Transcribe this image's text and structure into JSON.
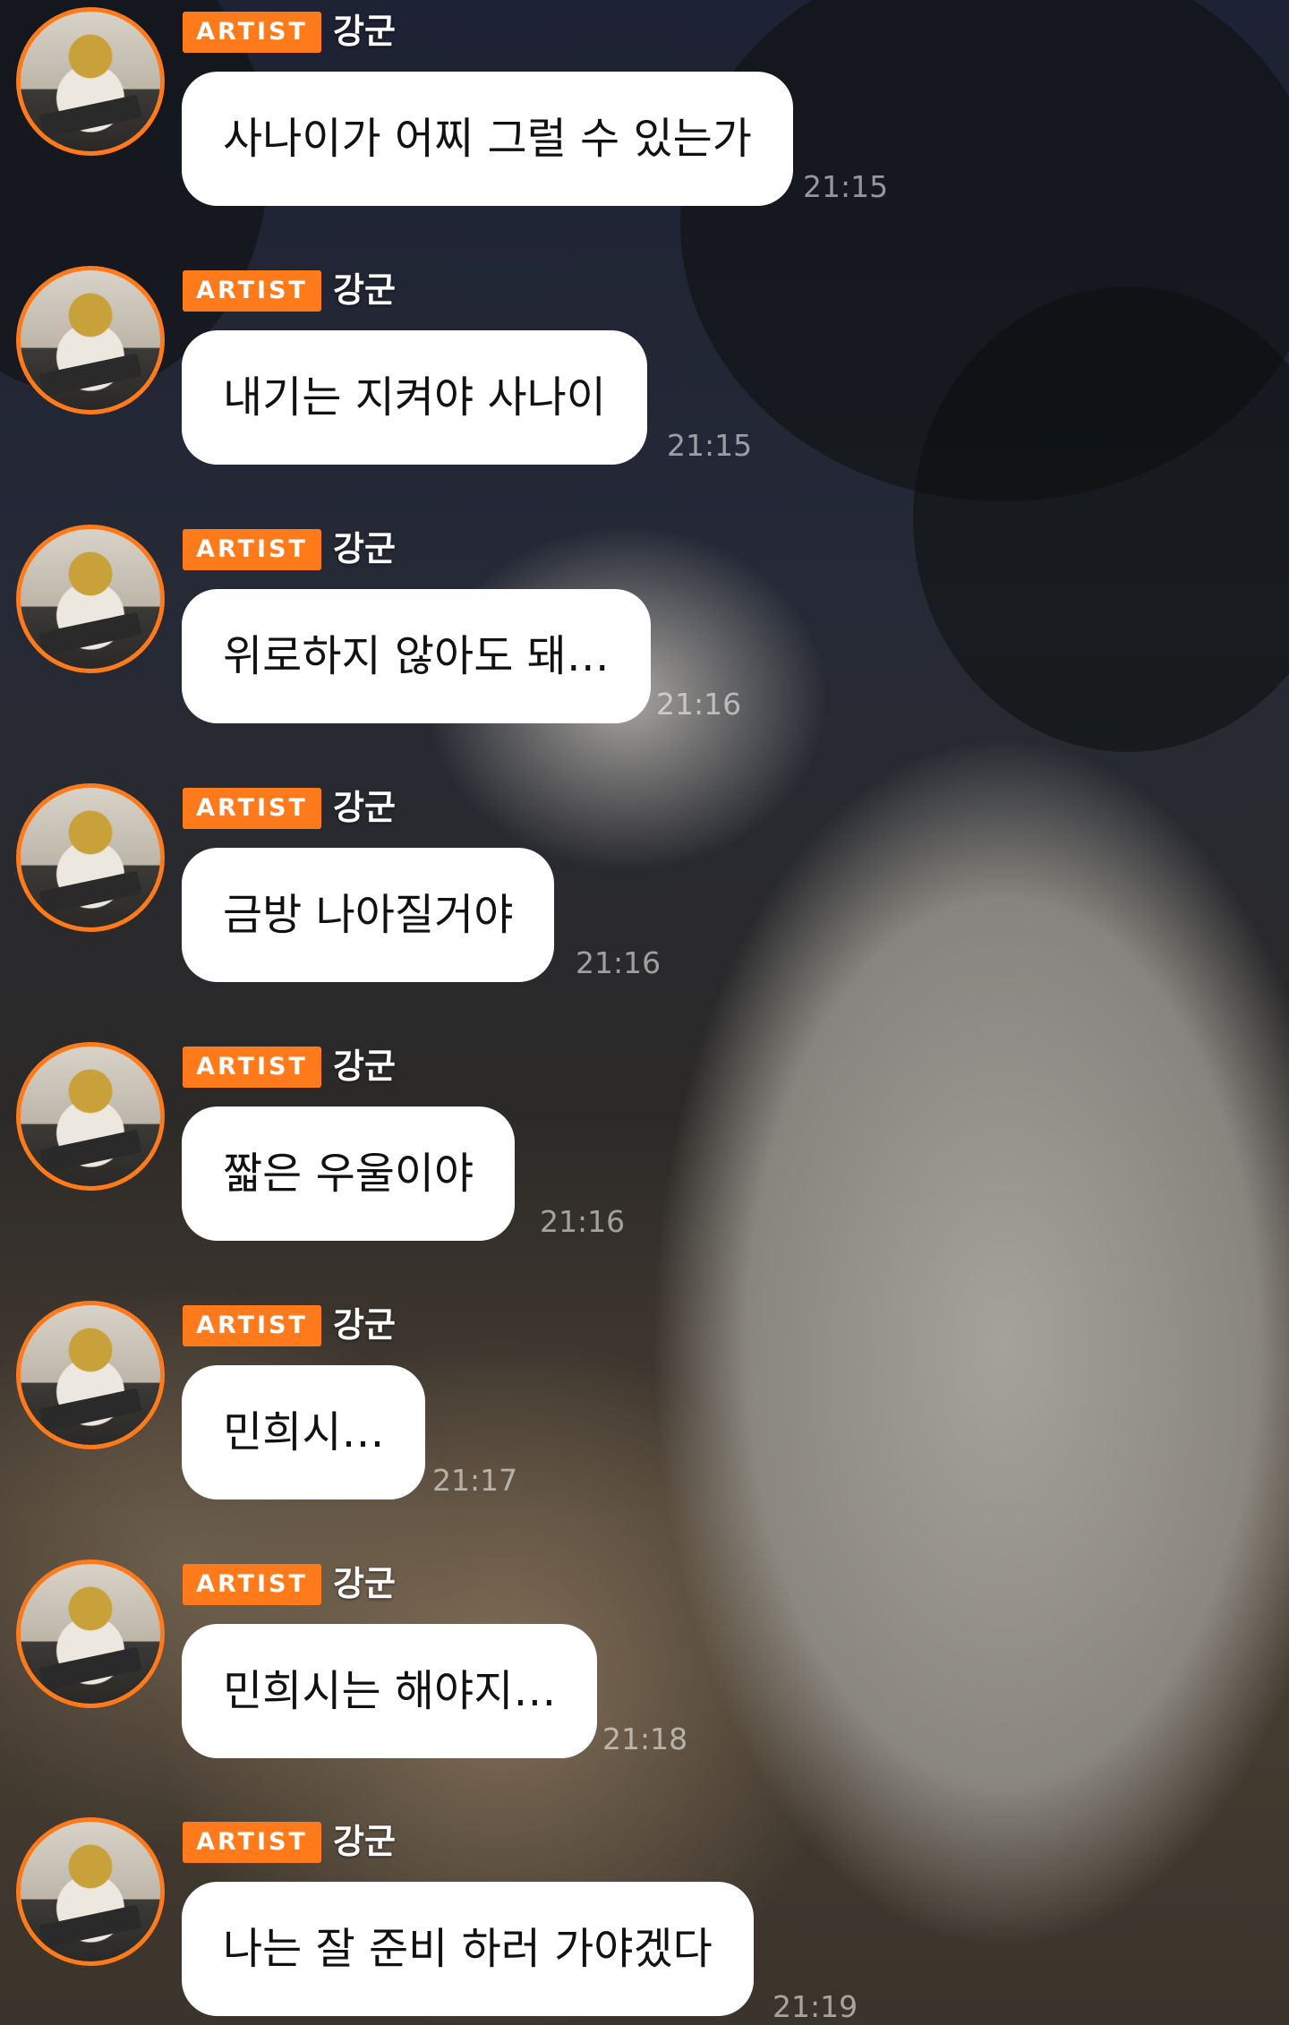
{
  "badge_label": "ARTIST",
  "accent_color": "#ff7a1a",
  "messages": [
    {
      "sender": "강군",
      "text": "사나이가 어찌 그럴 수 있는가",
      "time": "21:15"
    },
    {
      "sender": "강군",
      "text": "내기는 지켜야 사나이",
      "time": "21:15"
    },
    {
      "sender": "강군",
      "text": "위로하지 않아도 돼…",
      "time": "21:16"
    },
    {
      "sender": "강군",
      "text": "금방 나아질거야",
      "time": "21:16"
    },
    {
      "sender": "강군",
      "text": "짧은 우울이야",
      "time": "21:16"
    },
    {
      "sender": "강군",
      "text": "민희시…",
      "time": "21:17"
    },
    {
      "sender": "강군",
      "text": "민희시는 해야지…",
      "time": "21:18"
    },
    {
      "sender": "강군",
      "text": "나는 잘 준비 하러 가야겠다",
      "time": "21:19"
    }
  ]
}
